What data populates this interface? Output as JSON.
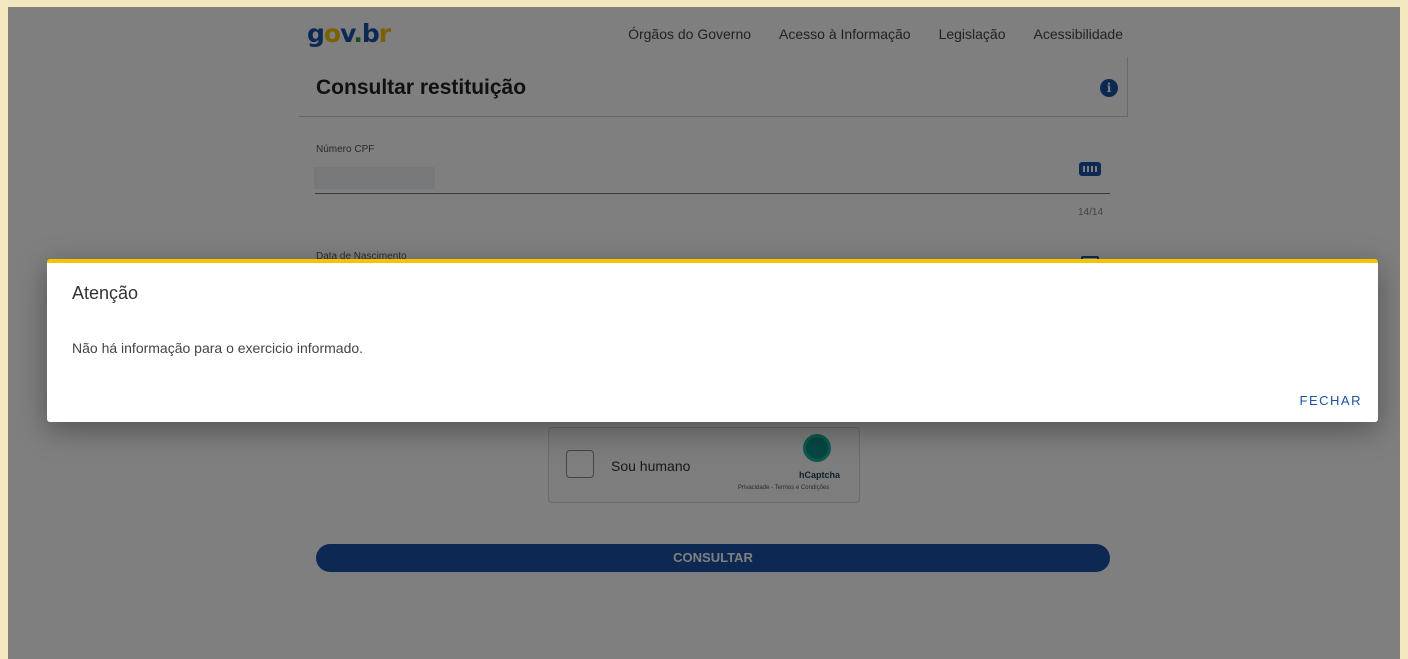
{
  "header": {
    "logo": {
      "g": "g",
      "o": "o",
      "v": "v",
      "dot": ".",
      "b": "b",
      "r": "r"
    },
    "nav": [
      {
        "label": "Órgãos do Governo"
      },
      {
        "label": "Acesso à Informação"
      },
      {
        "label": "Legislação"
      },
      {
        "label": "Acessibilidade"
      }
    ]
  },
  "page": {
    "title": "Consultar restituição"
  },
  "form": {
    "cpf_label": "Número CPF",
    "cpf_value": "",
    "cpf_counter": "14/14",
    "birthdate_label": "Data de Nascimento"
  },
  "captcha": {
    "label": "Sou humano",
    "brand": "hCaptcha",
    "links": "Privacidade - Termos e Condições"
  },
  "actions": {
    "consultar_label": "CONSULTAR"
  },
  "dialog": {
    "title": "Atenção",
    "message": "Não há informação para o exercicio informado.",
    "close_label": "FECHAR"
  },
  "colors": {
    "brand_blue": "#1b53a6",
    "accent_yellow": "#f5c400",
    "frame": "#f3e7bf"
  }
}
